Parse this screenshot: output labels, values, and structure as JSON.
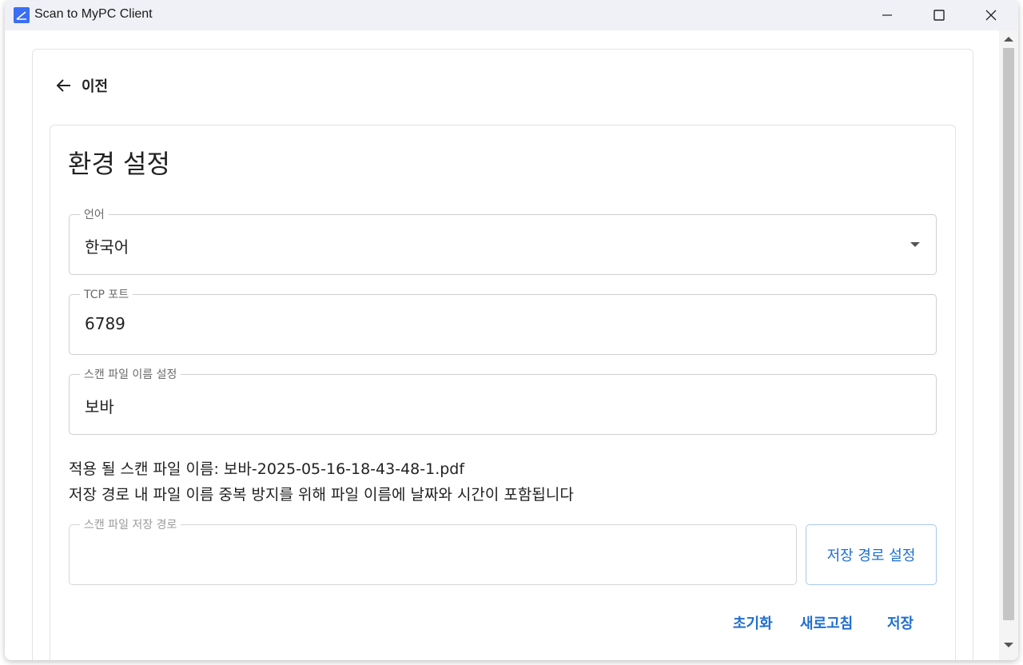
{
  "window": {
    "title": "Scan to MyPC Client"
  },
  "nav": {
    "back_label": "이전"
  },
  "page": {
    "title": "환경 설정"
  },
  "fields": {
    "language": {
      "label": "언어",
      "value": "한국어"
    },
    "tcp_port": {
      "label": "TCP 포트",
      "value": "6789"
    },
    "file_name": {
      "label": "스캔 파일 이름 설정",
      "value": "보바"
    },
    "save_path": {
      "label": "스캔 파일 저장 경로",
      "value": ""
    }
  },
  "info": {
    "applied_name": "적용 될 스캔 파일 이름: 보바-2025-05-16-18-43-48-1.pdf",
    "note": "저장 경로 내 파일 이름 중복 방지를 위해 파일 이름에 날짜와 시간이 포함됩니다"
  },
  "buttons": {
    "set_path": "저장 경로 설정",
    "reset": "초기화",
    "refresh": "새로고침",
    "save": "저장"
  },
  "colors": {
    "accent": "#1f6fd1",
    "titlebar": "#f0f1f6",
    "app_icon": "#3b6ef5"
  },
  "icons": {
    "app": "app-icon",
    "back": "arrow-left-icon",
    "minimize": "minimize-icon",
    "maximize": "maximize-icon",
    "close": "close-icon",
    "dropdown": "caret-down-icon"
  }
}
